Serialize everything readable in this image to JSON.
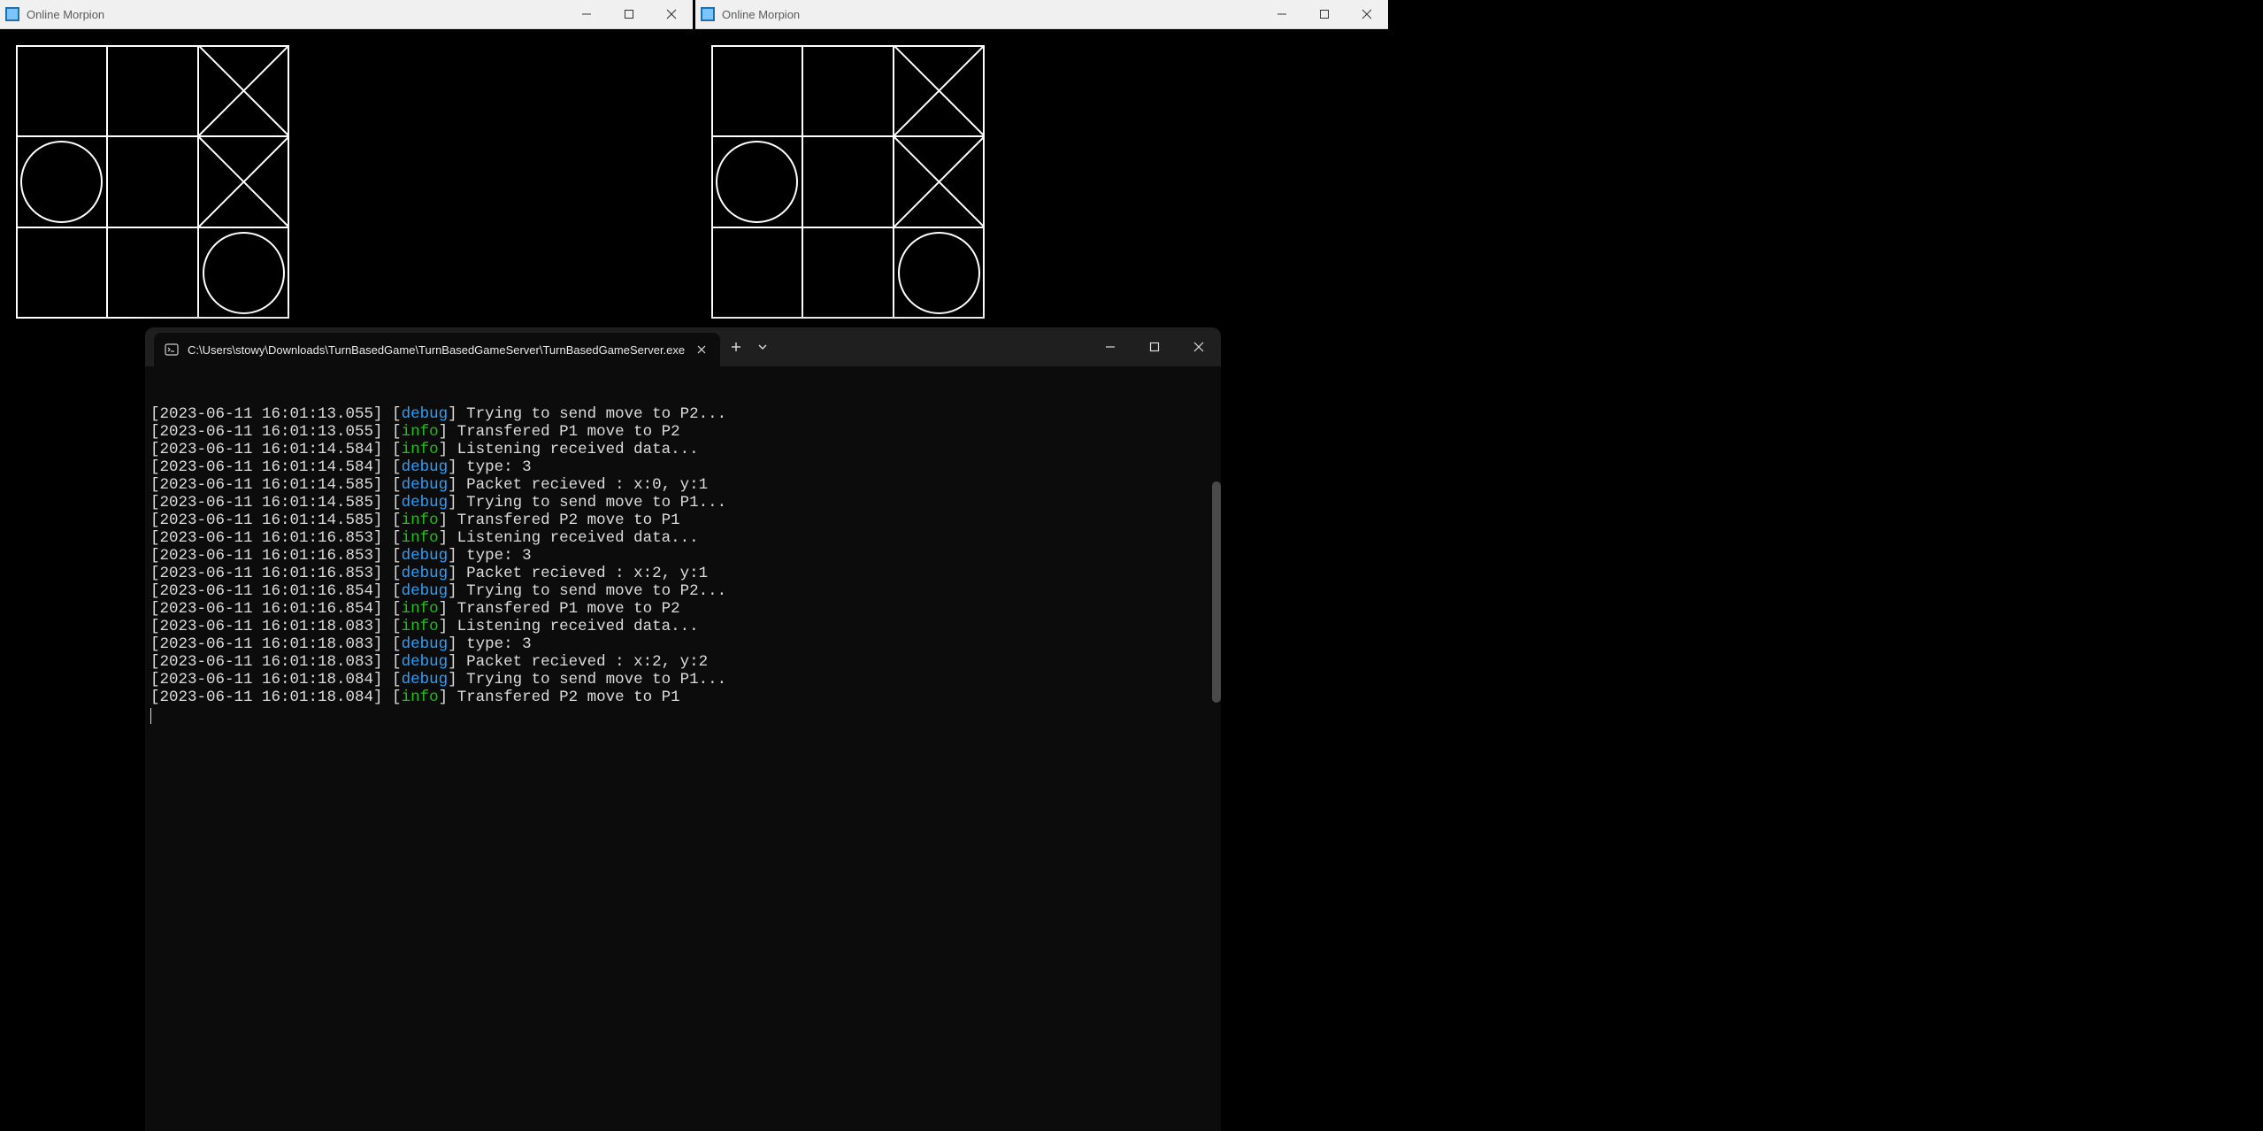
{
  "app": {
    "title": "Online Morpion"
  },
  "game_board": {
    "cells": [
      [
        "",
        "",
        "X"
      ],
      [
        "O",
        "",
        "X"
      ],
      [
        "",
        "",
        "O"
      ]
    ]
  },
  "terminal": {
    "tab_title": "C:\\Users\\stowy\\Downloads\\TurnBasedGame\\TurnBasedGameServer\\TurnBasedGameServer.exe",
    "logs": [
      {
        "ts": "2023-06-11 16:01:13.055",
        "level": "debug",
        "msg": "Trying to send move to P2..."
      },
      {
        "ts": "2023-06-11 16:01:13.055",
        "level": "info",
        "msg": "Transfered P1 move to P2"
      },
      {
        "ts": "2023-06-11 16:01:14.584",
        "level": "info",
        "msg": "Listening received data..."
      },
      {
        "ts": "2023-06-11 16:01:14.584",
        "level": "debug",
        "msg": "type: 3"
      },
      {
        "ts": "2023-06-11 16:01:14.585",
        "level": "debug",
        "msg": "Packet recieved : x:0, y:1"
      },
      {
        "ts": "2023-06-11 16:01:14.585",
        "level": "debug",
        "msg": "Trying to send move to P1..."
      },
      {
        "ts": "2023-06-11 16:01:14.585",
        "level": "info",
        "msg": "Transfered P2 move to P1"
      },
      {
        "ts": "2023-06-11 16:01:16.853",
        "level": "info",
        "msg": "Listening received data..."
      },
      {
        "ts": "2023-06-11 16:01:16.853",
        "level": "debug",
        "msg": "type: 3"
      },
      {
        "ts": "2023-06-11 16:01:16.853",
        "level": "debug",
        "msg": "Packet recieved : x:2, y:1"
      },
      {
        "ts": "2023-06-11 16:01:16.854",
        "level": "debug",
        "msg": "Trying to send move to P2..."
      },
      {
        "ts": "2023-06-11 16:01:16.854",
        "level": "info",
        "msg": "Transfered P1 move to P2"
      },
      {
        "ts": "2023-06-11 16:01:18.083",
        "level": "info",
        "msg": "Listening received data..."
      },
      {
        "ts": "2023-06-11 16:01:18.083",
        "level": "debug",
        "msg": "type: 3"
      },
      {
        "ts": "2023-06-11 16:01:18.083",
        "level": "debug",
        "msg": "Packet recieved : x:2, y:2"
      },
      {
        "ts": "2023-06-11 16:01:18.084",
        "level": "debug",
        "msg": "Trying to send move to P1..."
      },
      {
        "ts": "2023-06-11 16:01:18.084",
        "level": "info",
        "msg": "Transfered P2 move to P1"
      }
    ]
  },
  "colors": {
    "debug": "#2aa0ff",
    "info": "#16c60c"
  }
}
